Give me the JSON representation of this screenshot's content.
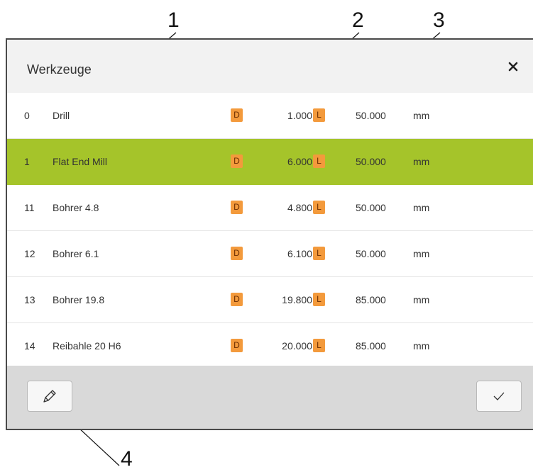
{
  "callouts": [
    "1",
    "2",
    "3",
    "4"
  ],
  "dialog": {
    "title": "Werkzeuge",
    "close_icon": "close-icon"
  },
  "tools": [
    {
      "number": "0",
      "name": "Drill",
      "d_label": "D",
      "diameter": "1.000",
      "l_label": "L",
      "length": "50.000",
      "unit": "mm",
      "selected": false
    },
    {
      "number": "1",
      "name": "Flat End Mill",
      "d_label": "D",
      "diameter": "6.000",
      "l_label": "L",
      "length": "50.000",
      "unit": "mm",
      "selected": true
    },
    {
      "number": "11",
      "name": "Bohrer 4.8",
      "d_label": "D",
      "diameter": "4.800",
      "l_label": "L",
      "length": "50.000",
      "unit": "mm",
      "selected": false
    },
    {
      "number": "12",
      "name": "Bohrer 6.1",
      "d_label": "D",
      "diameter": "6.100",
      "l_label": "L",
      "length": "50.000",
      "unit": "mm",
      "selected": false
    },
    {
      "number": "13",
      "name": "Bohrer 19.8",
      "d_label": "D",
      "diameter": "19.800",
      "l_label": "L",
      "length": "85.000",
      "unit": "mm",
      "selected": false
    },
    {
      "number": "14",
      "name": "Reibahle 20 H6",
      "d_label": "D",
      "diameter": "20.000",
      "l_label": "L",
      "length": "85.000",
      "unit": "mm",
      "selected": false
    }
  ],
  "footer": {
    "edit_icon": "pencil-icon",
    "confirm_icon": "checkmark-icon"
  },
  "colors": {
    "selected_row": "#a5c42a",
    "badge": "#f39a3c",
    "header_bg": "#f2f2f2",
    "footer_bg": "#d9d9d9"
  }
}
